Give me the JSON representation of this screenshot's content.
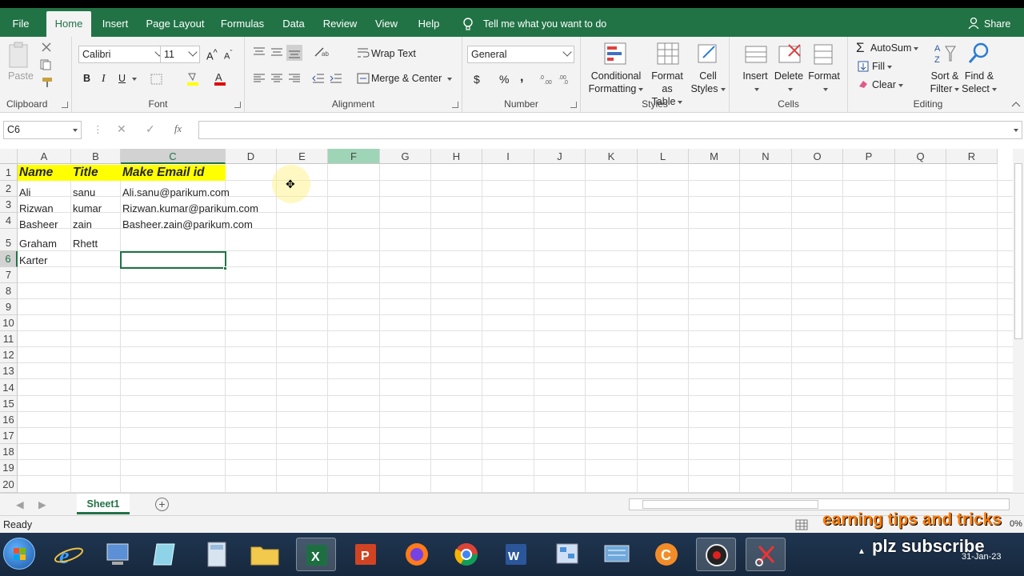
{
  "tabs": [
    "File",
    "Home",
    "Insert",
    "Page Layout",
    "Formulas",
    "Data",
    "Review",
    "View",
    "Help"
  ],
  "tell_me": "Tell me what you want to do",
  "share": "Share",
  "ribbon": {
    "clipboard": {
      "label": "Clipboard",
      "paste": "Paste"
    },
    "font": {
      "label": "Font",
      "name": "Calibri",
      "size": "11",
      "bold": "B",
      "italic": "I",
      "underline": "U"
    },
    "alignment": {
      "label": "Alignment",
      "wrap": "Wrap Text",
      "merge": "Merge & Center"
    },
    "number": {
      "label": "Number",
      "format": "General",
      "currency": "$",
      "percent": "%",
      "comma": ","
    },
    "styles": {
      "label": "Styles",
      "cond1": "Conditional",
      "cond2": "Formatting",
      "fmt1": "Format as",
      "fmt2": "Table",
      "cell1": "Cell",
      "cell2": "Styles"
    },
    "cells": {
      "label": "Cells",
      "insert": "Insert",
      "delete": "Delete",
      "format": "Format"
    },
    "editing": {
      "label": "Editing",
      "autosum": "AutoSum",
      "fill": "Fill",
      "clear": "Clear",
      "sort1": "Sort &",
      "sort2": "Filter",
      "find1": "Find &",
      "find2": "Select"
    }
  },
  "formula_bar": {
    "name_box": "C6",
    "fx": "fx",
    "value": ""
  },
  "columns": [
    "A",
    "B",
    "C",
    "D",
    "E",
    "F",
    "G",
    "H",
    "I",
    "J",
    "K",
    "L",
    "M",
    "N",
    "O",
    "P",
    "Q",
    "R"
  ],
  "rows": [
    "1",
    "2",
    "3",
    "4",
    "5",
    "6",
    "7",
    "8",
    "9",
    "10",
    "11",
    "12",
    "13",
    "14",
    "15",
    "16",
    "17",
    "18",
    "19",
    "20"
  ],
  "cells": {
    "A1": "Name",
    "B1": "Title",
    "C1": "Make Email id",
    "A2": "Ali",
    "B2": "sanu",
    "C2": "Ali.sanu@parikum.com",
    "A3": "Rizwan",
    "B3": "kumar",
    "C3": "Rizwan.kumar@parikum.com",
    "A4": "Basheer",
    "B4": "zain",
    "C4": "Basheer.zain@parikum.com",
    "A5": "Graham",
    "B5": "Rhett",
    "A6": "Karter"
  },
  "sheet_tab": "Sheet1",
  "status": "Ready",
  "overlay": {
    "line1": "earning tips and tricks",
    "line2": "plz subscribe",
    "date": "31-Jan-23",
    "zoom": "0%"
  },
  "colors": {
    "excel_green": "#217346",
    "header_fill": "#ffff00",
    "col_hl": "#9fd5b7"
  }
}
